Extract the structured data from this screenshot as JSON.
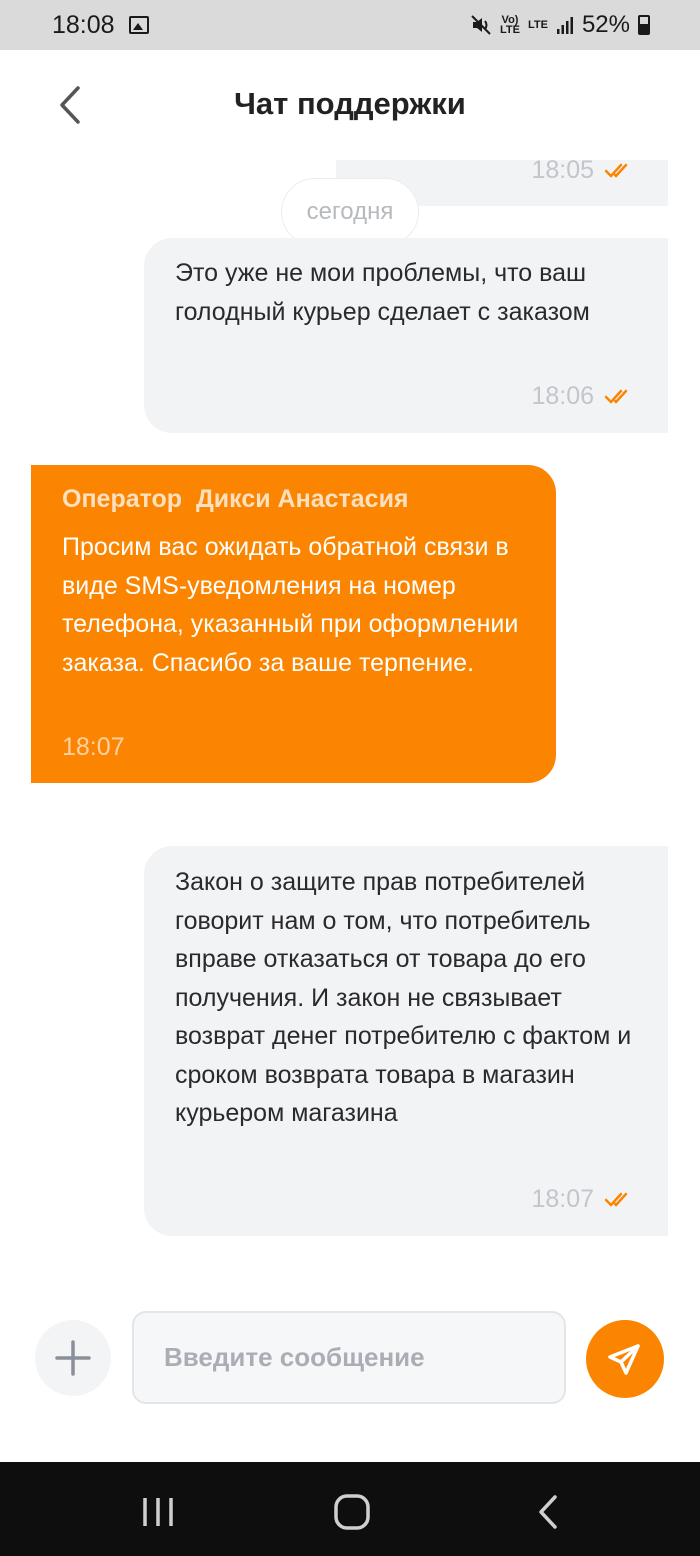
{
  "status_bar": {
    "time": "18:08",
    "volte": "Vo)\nLTE",
    "lte": "LTE",
    "battery": "52%"
  },
  "header": {
    "title": "Чат поддержки"
  },
  "messages": {
    "prev_time": "18:05",
    "date_divider": "сегодня",
    "m1": {
      "text": "Это уже не мои проблемы, что ваш голодный курьер сделает с заказом",
      "time": "18:06"
    },
    "m2": {
      "sender": "Оператор  Дикси Анастасия",
      "text": "Просим вас ожидать обратной связи в виде SMS-уведомления на номер телефона, указанный при оформлении заказа. Спасибо за ваше терпение.",
      "time": "18:07"
    },
    "m3": {
      "text": "Закон о защите прав потребителей говорит нам о том, что потребитель вправе отказаться от товара до его получения. И закон не связывает возврат денег потребителю с фактом и сроком возврата товара в магазин курьером магазина",
      "time": "18:07"
    }
  },
  "composer": {
    "placeholder": "Введите сообщение"
  },
  "colors": {
    "accent": "#fb8500",
    "bubble_out": "#f2f3f5",
    "meta_text": "#c2c6cc"
  },
  "icons": [
    "back-icon",
    "plus-icon",
    "send-icon",
    "double-check-icon",
    "recent-apps-icon",
    "home-icon",
    "nav-back-icon"
  ]
}
